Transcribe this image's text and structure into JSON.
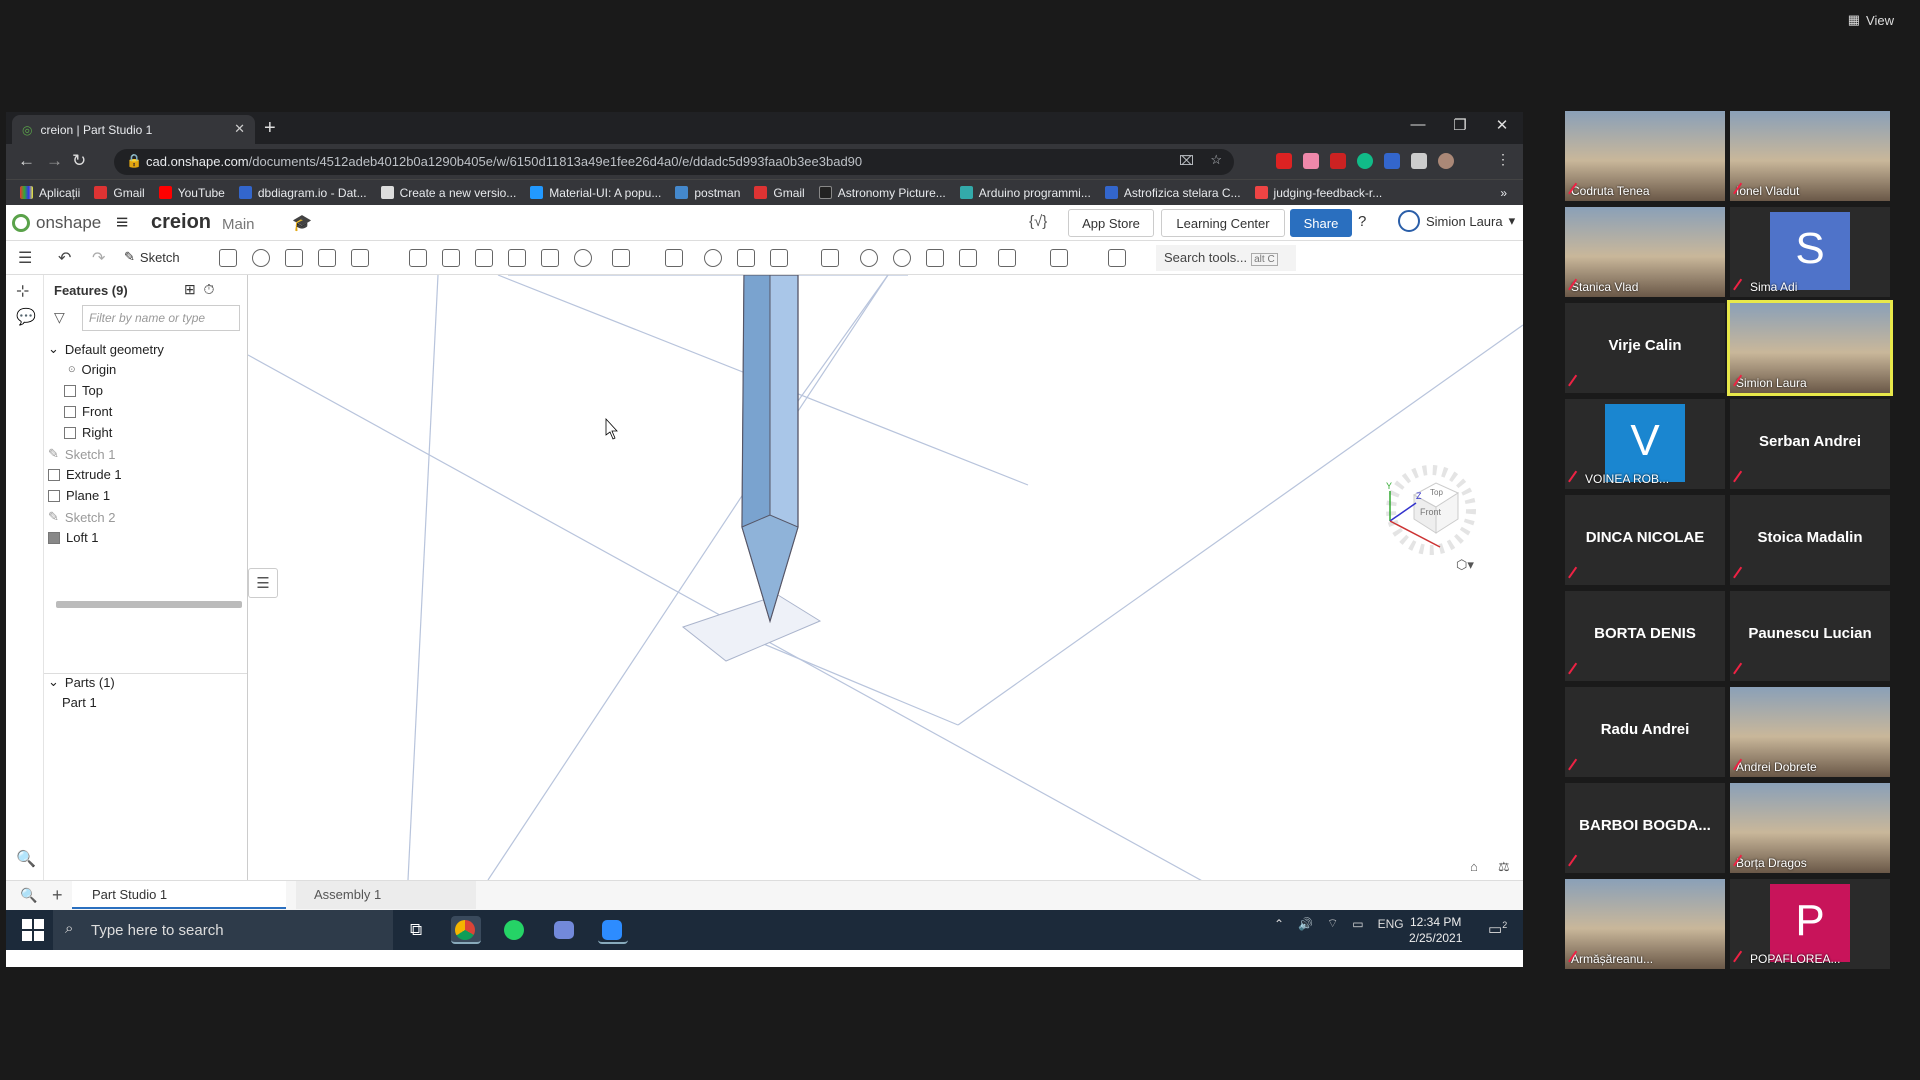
{
  "zoom": {
    "view_label": "View"
  },
  "browser": {
    "tab_title": "creion | Part Studio 1",
    "url_domain": "cad.onshape.com",
    "url_path": "/documents/4512adeb4012b0a1290b405e/w/6150d11813a49e1fee26d4a0/e/ddadc5d993faa0b3ee3bad90",
    "bookmarks": [
      "Aplicații",
      "Gmail",
      "YouTube",
      "dbdiagram.io - Dat...",
      "Create a new versio...",
      "Material-UI: A popu...",
      "postman",
      "Gmail",
      "Astronomy Picture...",
      "Arduino programmi...",
      "Astrofizica stelara C...",
      "judging-feedback-r..."
    ],
    "bookmark_more": "»"
  },
  "onshape": {
    "logo_text": "onshape",
    "doc_name": "creion",
    "branch": "Main",
    "variable_studio": "{√}",
    "app_store": "App Store",
    "learning_center": "Learning Center",
    "share": "Share",
    "help": "?",
    "user": "Simion Laura",
    "sketch_label": "Sketch",
    "search_tools": "Search tools...",
    "search_shortcut": "alt C"
  },
  "features": {
    "title": "Features (9)",
    "filter_placeholder": "Filter by name or type",
    "default_geometry": "Default geometry",
    "geometry_items": [
      "Origin",
      "Top",
      "Front",
      "Right"
    ],
    "items": [
      {
        "label": "Sketch 1",
        "dim": true
      },
      {
        "label": "Extrude 1",
        "dim": false
      },
      {
        "label": "Plane 1",
        "dim": false
      },
      {
        "label": "Sketch 2",
        "dim": true
      },
      {
        "label": "Loft 1",
        "dim": false
      }
    ],
    "parts_header": "Parts (1)",
    "parts": [
      "Part 1"
    ]
  },
  "viewcube": {
    "top": "Top",
    "front": "Front",
    "z": "Z",
    "y": "Y"
  },
  "bottom_tabs": {
    "tab1": "Part Studio 1",
    "tab2": "Assembly 1"
  },
  "taskbar": {
    "search_placeholder": "Type here to search",
    "lang": "ENG",
    "time": "12:34 PM",
    "date": "2/25/2021",
    "notif_count": "2"
  },
  "participants": [
    {
      "name": "Codruta Tenea",
      "type": "video"
    },
    {
      "name": "Ionel Vladut",
      "type": "video"
    },
    {
      "name": "Stanica Vlad",
      "type": "video"
    },
    {
      "name": "Sima Adi",
      "type": "letter",
      "letter": "S",
      "color": "#4f73c9"
    },
    {
      "name": "Virje Calin",
      "type": "name"
    },
    {
      "name": "Simion Laura",
      "type": "video",
      "active": true
    },
    {
      "name": "VOINEA ROB...",
      "type": "letter",
      "letter": "V",
      "color": "#1a86d0"
    },
    {
      "name": "Serban Andrei",
      "type": "name"
    },
    {
      "name": "DINCA NICOLAE",
      "type": "name"
    },
    {
      "name": "Stoica Madalin",
      "type": "name"
    },
    {
      "name": "BORTA DENIS",
      "type": "name"
    },
    {
      "name": "Paunescu Lucian",
      "type": "name"
    },
    {
      "name": "Radu Andrei",
      "type": "name"
    },
    {
      "name": "Andrei Dobrete",
      "type": "video"
    },
    {
      "name": "BARBOI BOGDA...",
      "type": "name"
    },
    {
      "name": "Borța Dragos",
      "type": "video"
    },
    {
      "name": "Armășăreanu...",
      "type": "video"
    },
    {
      "name": "POPAFLOREA...",
      "type": "letter",
      "letter": "P",
      "color": "#c8145a"
    }
  ],
  "colors": {
    "accent": "#2a6fbf",
    "zoom_bg": "#1a1a1a",
    "taskbar": "#1c2a3a",
    "active_speaker": "#e8e84a"
  }
}
